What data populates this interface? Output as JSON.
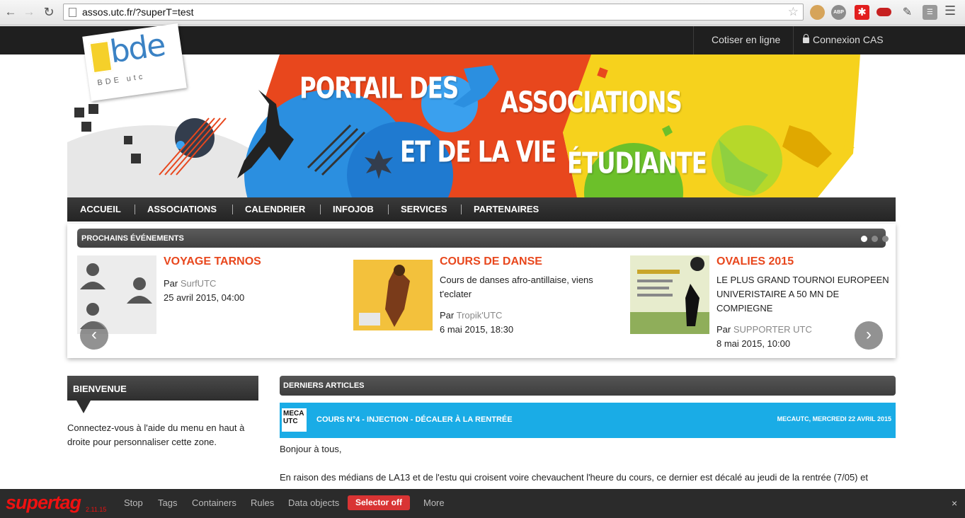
{
  "browser": {
    "url": "assos.utc.fr/?superT=test",
    "extensions": [
      "cookie-icon",
      "abp-icon",
      "red-plus-icon",
      "mask-icon",
      "pen-icon",
      "sheet-icon"
    ],
    "abp_label": "ABP"
  },
  "topbar": {
    "cotiser": "Cotiser en ligne",
    "cas": "Connexion CAS"
  },
  "banner": {
    "logo_text": "bde",
    "logo_sub": "BDE utc",
    "line1": "PORTAIL DES",
    "line2": "ASSOCIATIONS",
    "line3": "ET DE LA VIE",
    "line4": "ÉTUDIANTE",
    "colors": {
      "orange": "#e8471d",
      "blue": "#2b8fe0",
      "yellow": "#f6d21d",
      "green": "#6cc02a"
    }
  },
  "nav": {
    "items": [
      "ACCUEIL",
      "ASSOCIATIONS",
      "CALENDRIER",
      "INFOJOB",
      "SERVICES",
      "PARTENAIRES"
    ]
  },
  "events": {
    "title": "PROCHAINS ÉVÉNEMENTS",
    "items": [
      {
        "title": "VOYAGE TARNOS",
        "by_prefix": "Par ",
        "by": "SurfUTC",
        "date": "25 avril 2015, 04:00",
        "desc": ""
      },
      {
        "title": "COURS DE DANSE",
        "by_prefix": "Par ",
        "by": "Tropik'UTC",
        "date": "6 mai 2015, 18:30",
        "desc": "Cours de danses afro-antillaise, viens t'eclater"
      },
      {
        "title": "OVALIES 2015",
        "by_prefix": "Par ",
        "by": "SUPPORTER UTC",
        "date": "8 mai 2015, 10:00",
        "desc": "LE PLUS GRAND TOURNOI EUROPEEN UNIVERISTAIRE A 50 MN DE COMPIEGNE"
      }
    ],
    "prev_arrow": "‹",
    "next_arrow": "›"
  },
  "sidebar": {
    "title": "BIENVENUE",
    "text": "Connectez-vous à l'aide du menu en haut à droite pour personnaliser cette zone."
  },
  "articles": {
    "title": "DERNIERS ARTICLES",
    "item": {
      "thumb": "MECA UTC",
      "title": "COURS N°4 - INJECTION - DÉCALER À LA RENTRÉE",
      "meta": "MECAUTC, MERCREDI 22 AVRIL 2015",
      "p1": "Bonjour à tous,",
      "p2": "En raison des médians de LA13 et de l'estu qui croisent voire chevauchent l'heure du cours, ce dernier est décalé au jeudi de la rentrée (7/05) et"
    }
  },
  "supertag": {
    "logo": "supertag",
    "version": "2.11.15",
    "items": [
      "Stop",
      "Tags",
      "Containers",
      "Rules",
      "Data objects"
    ],
    "selector": "Selector off",
    "more": "More",
    "close": "×"
  }
}
